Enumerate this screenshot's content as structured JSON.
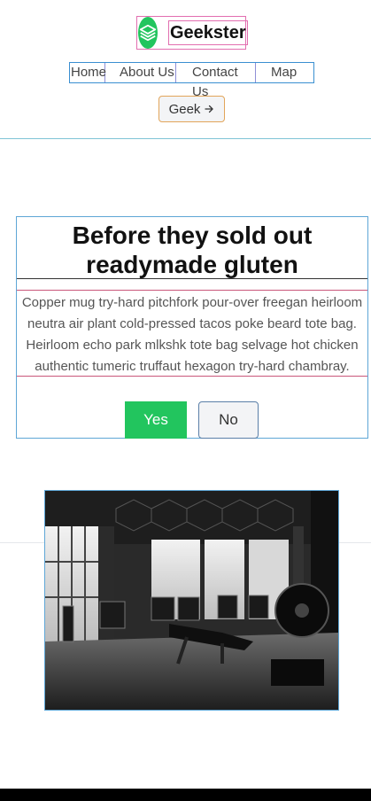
{
  "header": {
    "brand_name": "Geekster",
    "nav": [
      "Home",
      "About Us",
      "Contact Us",
      "Map"
    ],
    "cta_label": "Geek",
    "cta_icon": "arrow-right-icon",
    "logo_icon": "layers-icon",
    "accent": "#22c55e"
  },
  "card": {
    "title": "Before they sold out readymade gluten",
    "text": "Copper mug try-hard pitchfork pour-over freegan heirloom neutra air plant cold-pressed tacos poke beard tote bag. Heirloom echo park mlkshk tote bag selvage hot chicken authentic tumeric truffaut hexagon try-hard chambray.",
    "yes_label": "Yes",
    "no_label": "No"
  },
  "media": {
    "image_name": "gym-photo"
  }
}
